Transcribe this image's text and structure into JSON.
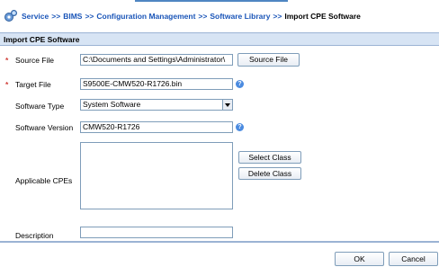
{
  "breadcrumb": {
    "items": [
      "Service",
      "BIMS",
      "Configuration Management",
      "Software Library"
    ],
    "separator": ">>",
    "current": "Import CPE Software"
  },
  "panel": {
    "title": "Import CPE Software"
  },
  "form": {
    "source_file": {
      "label": "Source File",
      "value": "C:\\Documents and Settings\\Administrator\\",
      "button": "Source File"
    },
    "target_file": {
      "label": "Target File",
      "value": "S9500E-CMW520-R1726.bin"
    },
    "software_type": {
      "label": "Software Type",
      "value": "System Software"
    },
    "software_version": {
      "label": "Software Version",
      "value": "CMW520-R1726"
    },
    "applicable_cpes": {
      "label": "Applicable CPEs",
      "select_button": "Select Class",
      "delete_button": "Delete Class"
    },
    "description": {
      "label": "Description",
      "value": ""
    },
    "required_mark": "*",
    "help_glyph": "?"
  },
  "footer": {
    "ok": "OK",
    "cancel": "Cancel"
  },
  "colors": {
    "link": "#1a55b8",
    "header_bg": "#d7e4f4",
    "required": "#d0403a",
    "border": "#7f9db9"
  }
}
